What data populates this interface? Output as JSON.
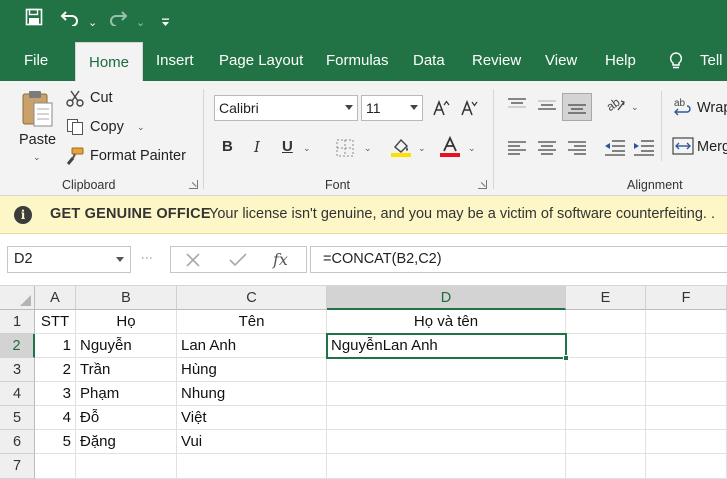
{
  "tabs": [
    "File",
    "Home",
    "Insert",
    "Page Layout",
    "Formulas",
    "Data",
    "Review",
    "View",
    "Help",
    "Tell"
  ],
  "active_tab": "Home",
  "clipboard": {
    "paste": "Paste",
    "cut": "Cut",
    "copy": "Copy",
    "format_painter": "Format Painter",
    "label": "Clipboard"
  },
  "font": {
    "name": "Calibri",
    "size": "11",
    "label": "Font",
    "font_color": "#e81123",
    "highlight_color": "#ffe100"
  },
  "alignment": {
    "wrap": "Wrap",
    "merge": "Merg",
    "label": "Alignment"
  },
  "license_bar": {
    "heading": "GET GENUINE OFFICE",
    "message": "Your license isn't genuine, and you may be a victim of software counterfeiting. ."
  },
  "formula_bar": {
    "name_box": "D2",
    "formula": "=CONCAT(B2,C2)"
  },
  "sheet": {
    "columns": [
      "A",
      "B",
      "C",
      "D",
      "E",
      "F"
    ],
    "selected_column": "D",
    "selected_row": "2",
    "rows": [
      {
        "n": "1",
        "a": "STT",
        "b": "Họ",
        "c": "Tên",
        "d": "Họ và tên"
      },
      {
        "n": "2",
        "a": "1",
        "b": "Nguyễn",
        "c": "Lan Anh",
        "d": "NguyễnLan Anh"
      },
      {
        "n": "3",
        "a": "2",
        "b": "Trần",
        "c": "Hùng",
        "d": ""
      },
      {
        "n": "4",
        "a": "3",
        "b": "Phạm",
        "c": "Nhung",
        "d": ""
      },
      {
        "n": "5",
        "a": "4",
        "b": "Đỗ",
        "c": "Việt",
        "d": ""
      },
      {
        "n": "6",
        "a": "5",
        "b": "Đặng",
        "c": "Vui",
        "d": ""
      },
      {
        "n": "7",
        "a": "",
        "b": "",
        "c": "",
        "d": ""
      }
    ]
  },
  "colors": {
    "brand": "#217346",
    "license_bg": "#fdf6c6"
  }
}
